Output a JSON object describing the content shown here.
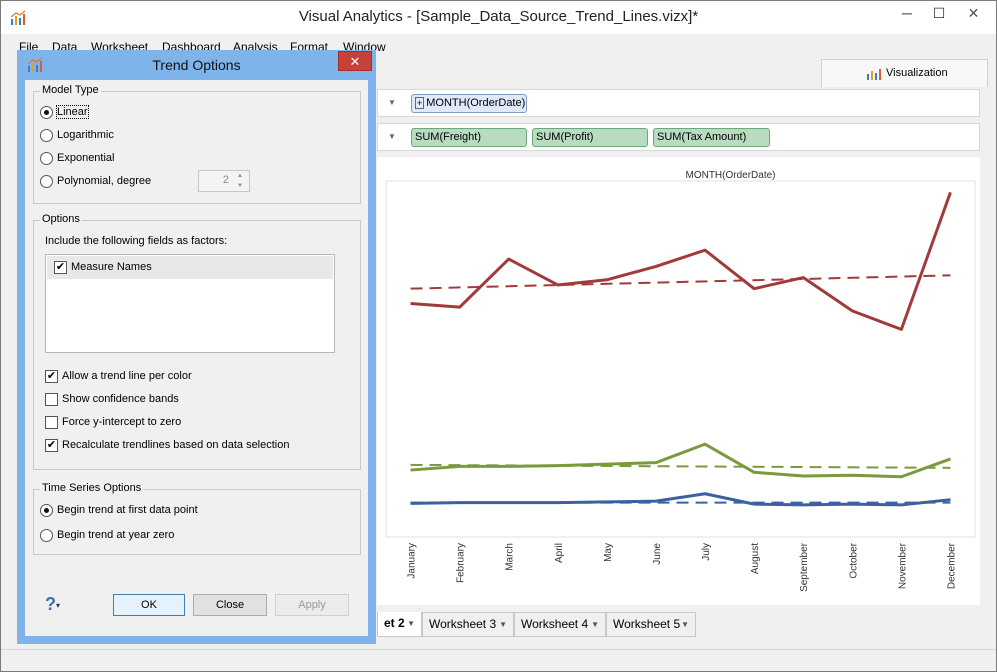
{
  "window": {
    "title": "Visual Analytics - [Sample_Data_Source_Trend_Lines.vizx]*",
    "minimize_glyph": "─",
    "maximize_glyph": "☐",
    "close_glyph": "✕"
  },
  "menu": [
    "File",
    "Data",
    "Worksheet",
    "Dashboard",
    "Analysis",
    "Format",
    "Window"
  ],
  "top_tab": {
    "label": "Visualization"
  },
  "shelves": {
    "columns": [
      "MONTH(OrderDate)"
    ],
    "rows": [
      "SUM(Freight)",
      "SUM(Profit)",
      "SUM(Tax Amount)"
    ]
  },
  "sheet_tabs": [
    {
      "label": "et 2",
      "active": true
    },
    {
      "label": "Worksheet 3",
      "active": false
    },
    {
      "label": "Worksheet 4",
      "active": false
    },
    {
      "label": "Worksheet 5",
      "active": false
    }
  ],
  "dialog": {
    "title": "Trend Options",
    "close_glyph": "✕",
    "model_type": {
      "legend": "Model Type",
      "options": [
        "Linear",
        "Logarithmic",
        "Exponential",
        "Polynomial, degree"
      ],
      "selected": "Linear",
      "degree": "2"
    },
    "options": {
      "legend": "Options",
      "factors_label": "Include the following fields as factors:",
      "factors": [
        {
          "label": "Measure Names",
          "checked": true
        }
      ],
      "checks": [
        {
          "label": "Allow a trend line per color",
          "checked": true
        },
        {
          "label": "Show confidence bands",
          "checked": false
        },
        {
          "label": "Force y-intercept to zero",
          "checked": false
        },
        {
          "label": "Recalculate trendlines based on data selection",
          "checked": true
        }
      ]
    },
    "time_series": {
      "legend": "Time Series Options",
      "options": [
        "Begin trend at first data point",
        "Begin trend at year zero"
      ],
      "selected": "Begin trend at first data point"
    },
    "buttons": {
      "ok": "OK",
      "close": "Close",
      "apply": "Apply",
      "help": "?"
    }
  },
  "chart_data": {
    "type": "line",
    "title": "MONTH(OrderDate)",
    "categories": [
      "January",
      "February",
      "March",
      "April",
      "May",
      "June",
      "July",
      "August",
      "September",
      "October",
      "November",
      "December"
    ],
    "series": [
      {
        "color": "#a33a3a",
        "values": [
          360,
          355,
          420,
          385,
          392,
          410,
          432,
          380,
          395,
          350,
          325,
          510
        ],
        "trend": [
          380,
          398
        ]
      },
      {
        "color": "#7a9a3e",
        "values": [
          135,
          140,
          140,
          141,
          143,
          145,
          170,
          132,
          127,
          128,
          126,
          150
        ],
        "trend": [
          142,
          138
        ]
      },
      {
        "color": "#3a62a0",
        "values": [
          90,
          91,
          91,
          91,
          92,
          93,
          103,
          89,
          88,
          89,
          88,
          95
        ],
        "trend": [
          91,
          91
        ]
      }
    ],
    "ylim": [
      50,
      520
    ],
    "grid": false
  }
}
